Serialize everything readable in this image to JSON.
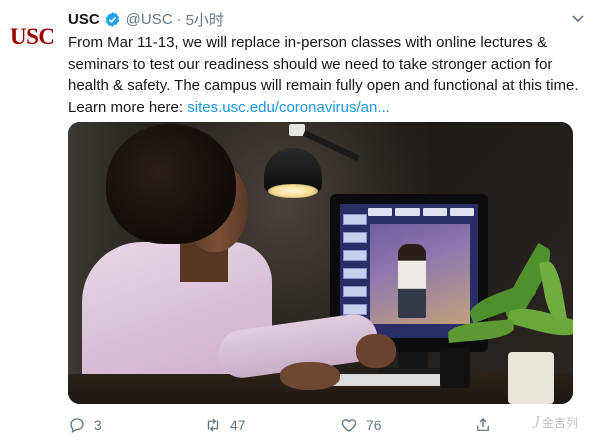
{
  "tweet": {
    "avatar_text": "USC",
    "name": "USC",
    "handle": "@USC",
    "separator": "·",
    "time": "5小时",
    "text": "From Mar 11-13, we will replace in-person classes with online lectures & seminars to test our readiness should we need to take stronger action for health & safety. The campus will remain fully open and functional at this time. Learn more here: ",
    "link": "sites.usc.edu/coronavirus/an..."
  },
  "actions": {
    "reply_count": "3",
    "retweet_count": "47",
    "like_count": "76"
  },
  "watermark": {
    "logo": "J",
    "text": "金吉列"
  },
  "colors": {
    "brand": "#990000",
    "link": "#1b95e0",
    "verified": "#1da1f2",
    "muted": "#657786"
  },
  "icons": [
    "verified-badge-icon",
    "chevron-down-icon",
    "reply-icon",
    "retweet-icon",
    "like-icon",
    "share-icon"
  ]
}
